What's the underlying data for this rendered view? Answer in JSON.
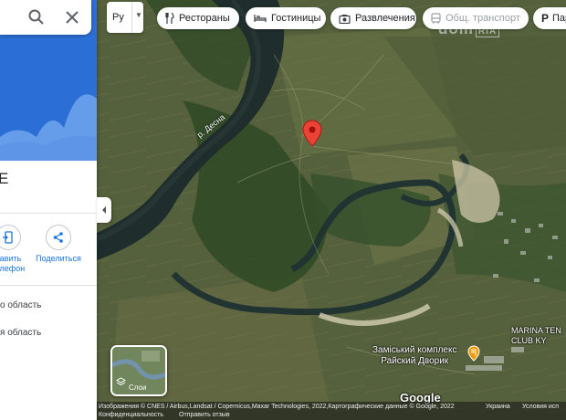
{
  "search": {
    "search_icon": "search-icon",
    "close_icon": "close-icon"
  },
  "place_panel": {
    "title": "E",
    "actions": [
      {
        "icon": "phone-send-icon",
        "label_line1": "равить",
        "label_line2": "телефон"
      },
      {
        "icon": "share-icon",
        "label_line1": "Поделиться",
        "label_line2": ""
      }
    ],
    "info_lines": [
      "о область",
      "я область"
    ]
  },
  "language_select": {
    "value": "Ру"
  },
  "categories": [
    {
      "icon": "fork-knife-icon",
      "label": "Рестораны"
    },
    {
      "icon": "bed-icon",
      "label": "Гостиницы"
    },
    {
      "icon": "camera-icon",
      "label": "Развлечения"
    },
    {
      "icon": "bus-icon",
      "label": "Общ. транспорт"
    },
    {
      "icon": "parking-icon",
      "label": "Пар"
    }
  ],
  "watermark": {
    "brand": "dom",
    "suffix": "RIA"
  },
  "map": {
    "river_label": "р. Десна",
    "poi": {
      "line1": "Заміський комплекс",
      "line2": "Райский Дворик",
      "icon": "restaurant-pin-icon"
    },
    "club": {
      "line1": "MARINA TEN",
      "line2": "CLUB KY"
    },
    "marker_icon": "location-pin-icon",
    "marker_color": "#ea4335"
  },
  "layers": {
    "label": "Слои"
  },
  "footer": {
    "logo": "Google",
    "attribution": "Изображения © CNES / Airbus,Landsat / Copernicus,Maxar Technologies, 2022,Картографические данные © Google, 2022",
    "country": "Украина",
    "terms": "Условия исп",
    "privacy": "Конфиденциальность",
    "feedback": "Отправить отзыв"
  }
}
